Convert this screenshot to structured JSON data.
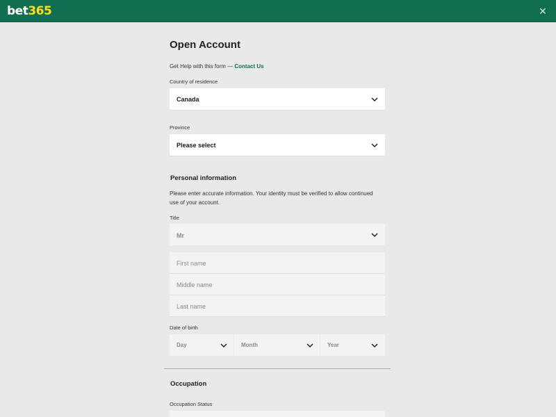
{
  "header": {
    "logo_part1": "bet",
    "logo_part2": "365",
    "close_glyph": "✕",
    "bg_color": "#126e51",
    "logo_accent": "#ffdf1b"
  },
  "form": {
    "title": "Open Account",
    "help_text": "Get Help with this form — ",
    "help_link": "Contact Us",
    "country_label": "Country of residence",
    "country_value": "Canada",
    "province_label": "Province",
    "province_value": "Please select",
    "personal_heading": "Personal information",
    "personal_note": "Please enter accurate information. Your identity must be verified to allow continued use of your account.",
    "title_label": "Title",
    "title_value": "Mr",
    "first_name_placeholder": "First name",
    "middle_name_placeholder": "Middle name",
    "last_name_placeholder": "Last name",
    "dob_label": "Date of birth",
    "dob_day": "Day",
    "dob_month": "Month",
    "dob_year": "Year",
    "occupation_heading": "Occupation",
    "occupation_status_label": "Occupation Status"
  },
  "icons": {
    "close": "close-icon",
    "dropdown": "chevron-down-icon"
  }
}
